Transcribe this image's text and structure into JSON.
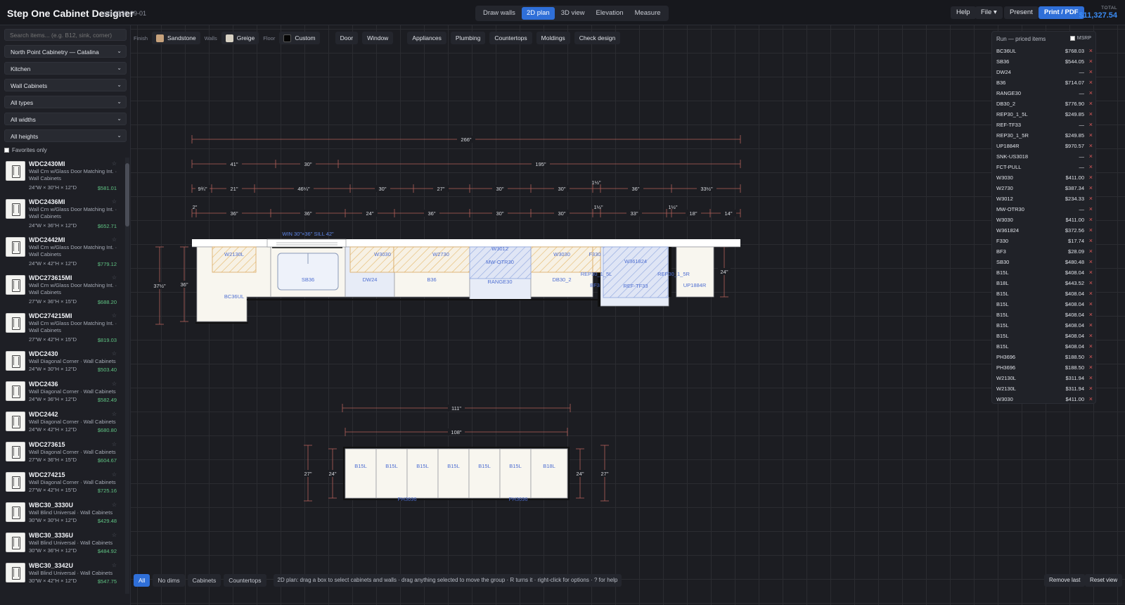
{
  "app": {
    "title": "Step One Cabinet Designer",
    "job_id": "job-2026-09-01"
  },
  "modes": [
    {
      "label": "Draw walls",
      "active": false
    },
    {
      "label": "2D plan",
      "active": true
    },
    {
      "label": "3D view",
      "active": false
    },
    {
      "label": "Elevation",
      "active": false
    },
    {
      "label": "Measure",
      "active": false
    }
  ],
  "top_actions": {
    "help": "Help",
    "file": "File ▾",
    "present": "Present",
    "print": "Print / PDF",
    "total_label": "TOTAL",
    "total_value": "$11,327.54"
  },
  "sidebar": {
    "search_placeholder": "Search items... (e.g. B12, sink, corner)",
    "filters": [
      "North Point Cabinetry — Catalina",
      "Kitchen",
      "Wall Cabinets",
      "All types",
      "All widths",
      "All heights"
    ],
    "favorites_label": "Favorites only",
    "items": [
      {
        "code": "WDC2430MI",
        "desc": "Wall Crn w/Glass Door Matching Int. · Wall Cabinets",
        "dims": "24\"W × 30\"H × 12\"D",
        "price": "$581.01"
      },
      {
        "code": "WDC2436MI",
        "desc": "Wall Crn w/Glass Door Matching Int. · Wall Cabinets",
        "dims": "24\"W × 36\"H × 12\"D",
        "price": "$652.71"
      },
      {
        "code": "WDC2442MI",
        "desc": "Wall Crn w/Glass Door Matching Int. · Wall Cabinets",
        "dims": "24\"W × 42\"H × 12\"D",
        "price": "$779.12"
      },
      {
        "code": "WDC273615MI",
        "desc": "Wall Crn w/Glass Door Matching Int. · Wall Cabinets",
        "dims": "27\"W × 36\"H × 15\"D",
        "price": "$688.20"
      },
      {
        "code": "WDC274215MI",
        "desc": "Wall Crn w/Glass Door Matching Int. · Wall Cabinets",
        "dims": "27\"W × 42\"H × 15\"D",
        "price": "$819.03"
      },
      {
        "code": "WDC2430",
        "desc": "Wall Diagonal Corner · Wall Cabinets",
        "dims": "24\"W × 30\"H × 12\"D",
        "price": "$503.40"
      },
      {
        "code": "WDC2436",
        "desc": "Wall Diagonal Corner · Wall Cabinets",
        "dims": "24\"W × 36\"H × 12\"D",
        "price": "$582.49"
      },
      {
        "code": "WDC2442",
        "desc": "Wall Diagonal Corner · Wall Cabinets",
        "dims": "24\"W × 42\"H × 12\"D",
        "price": "$680.80"
      },
      {
        "code": "WDC273615",
        "desc": "Wall Diagonal Corner · Wall Cabinets",
        "dims": "27\"W × 36\"H × 15\"D",
        "price": "$604.67"
      },
      {
        "code": "WDC274215",
        "desc": "Wall Diagonal Corner · Wall Cabinets",
        "dims": "27\"W × 42\"H × 15\"D",
        "price": "$725.16"
      },
      {
        "code": "WBC30_3330U",
        "desc": "Wall Blind Universal · Wall Cabinets",
        "dims": "30\"W × 30\"H × 12\"D",
        "price": "$429.48"
      },
      {
        "code": "WBC30_3336U",
        "desc": "Wall Blind Universal · Wall Cabinets",
        "dims": "30\"W × 36\"H × 12\"D",
        "price": "$484.92"
      },
      {
        "code": "WBC30_3342U",
        "desc": "Wall Blind Universal · Wall Cabinets",
        "dims": "30\"W × 42\"H × 12\"D",
        "price": "$547.75"
      }
    ]
  },
  "toolbar": {
    "finish_label": "Finish",
    "finish_value": "Sandstone",
    "finish_color": "#c7a27c",
    "walls_label": "Walls",
    "walls_value": "Greige",
    "walls_color": "#d8d2c4",
    "floor_label": "Floor",
    "floor_value": "Custom",
    "floor_color": "#050505",
    "tools": [
      "Door",
      "Window",
      "Appliances",
      "Plumbing",
      "Countertops",
      "Moldings",
      "Check design"
    ]
  },
  "plan": {
    "dimension_rows": [
      [
        "266\""
      ],
      [
        "41\"",
        "30\"",
        "195\""
      ],
      [
        "9¾\"",
        "21\"",
        "46¼\"",
        "30\"",
        "27\"",
        "30\"",
        "30\"",
        "1½\"",
        "36\"",
        "33½\""
      ],
      [
        "2\"",
        "36\"",
        "36\"",
        "24\"",
        "36\"",
        "30\"",
        "30\"",
        "1½\"",
        "33\"",
        "1½\"",
        "18\"",
        "14\""
      ]
    ],
    "window_label": "WIN 30\"×36\" SILL 42\"",
    "cabinet_labels": [
      "W2130L",
      "BC36UL",
      "SB36",
      "W3030",
      "DW24",
      "W2730",
      "B36",
      "W3012",
      "MW-OTR30",
      "RANGE30",
      "W3030",
      "DB30_2",
      "F330",
      "REP30_1_5L",
      "BF3",
      "W361824",
      "REF-TF33",
      "REP30_1_5R",
      "UP1884R"
    ],
    "height_labels": [
      "37½\"",
      "36\"",
      "24\""
    ],
    "island_dims": [
      "111\"",
      "108\""
    ],
    "island_cabinets": [
      "B15L",
      "B15L",
      "B15L",
      "B15L",
      "B15L",
      "B15L",
      "B18L"
    ],
    "island_heights": [
      "27\"",
      "24\"",
      "24\"",
      "27\""
    ],
    "island_panels": [
      "PH3696",
      "PH3696"
    ]
  },
  "run_panel": {
    "title": "Run — priced items",
    "msrp_label": "MSRP",
    "rows": [
      {
        "code": "BC36UL",
        "price": "$768.03"
      },
      {
        "code": "SB36",
        "price": "$544.05"
      },
      {
        "code": "DW24",
        "price": "—"
      },
      {
        "code": "B36",
        "price": "$714.07"
      },
      {
        "code": "RANGE30",
        "price": "—"
      },
      {
        "code": "DB30_2",
        "price": "$776.90"
      },
      {
        "code": "REP30_1_5L",
        "price": "$249.85"
      },
      {
        "code": "REF-TF33",
        "price": "—"
      },
      {
        "code": "REP30_1_5R",
        "price": "$249.85"
      },
      {
        "code": "UP1884R",
        "price": "$970.57"
      },
      {
        "code": "SNK-US3018",
        "price": "—"
      },
      {
        "code": "FCT-PULL",
        "price": "—"
      },
      {
        "code": "W3030",
        "price": "$411.00"
      },
      {
        "code": "W2730",
        "price": "$387.34"
      },
      {
        "code": "W3012",
        "price": "$234.33"
      },
      {
        "code": "MW-OTR30",
        "price": "—"
      },
      {
        "code": "W3030",
        "price": "$411.00"
      },
      {
        "code": "W361824",
        "price": "$372.56"
      },
      {
        "code": "F330",
        "price": "$17.74"
      },
      {
        "code": "BF3",
        "price": "$28.09"
      },
      {
        "code": "SB30",
        "price": "$480.48"
      },
      {
        "code": "B15L",
        "price": "$408.04"
      },
      {
        "code": "B18L",
        "price": "$443.52"
      },
      {
        "code": "B15L",
        "price": "$408.04"
      },
      {
        "code": "B15L",
        "price": "$408.04"
      },
      {
        "code": "B15L",
        "price": "$408.04"
      },
      {
        "code": "B15L",
        "price": "$408.04"
      },
      {
        "code": "B15L",
        "price": "$408.04"
      },
      {
        "code": "B15L",
        "price": "$408.04"
      },
      {
        "code": "PH3696",
        "price": "$188.50"
      },
      {
        "code": "PH3696",
        "price": "$188.50"
      },
      {
        "code": "W2130L",
        "price": "$311.94"
      },
      {
        "code": "W2130L",
        "price": "$311.94"
      },
      {
        "code": "W3030",
        "price": "$411.00"
      }
    ]
  },
  "bottom": {
    "filters": [
      {
        "label": "All",
        "active": true
      },
      {
        "label": "No dims",
        "active": false
      },
      {
        "label": "Cabinets",
        "active": false
      },
      {
        "label": "Countertops",
        "active": false
      }
    ],
    "hint": "2D plan: drag a box to select cabinets and walls · drag anything selected to move the group · R turns it · right-click for options · ? for help",
    "remove_last": "Remove last",
    "reset_view": "Reset view"
  }
}
